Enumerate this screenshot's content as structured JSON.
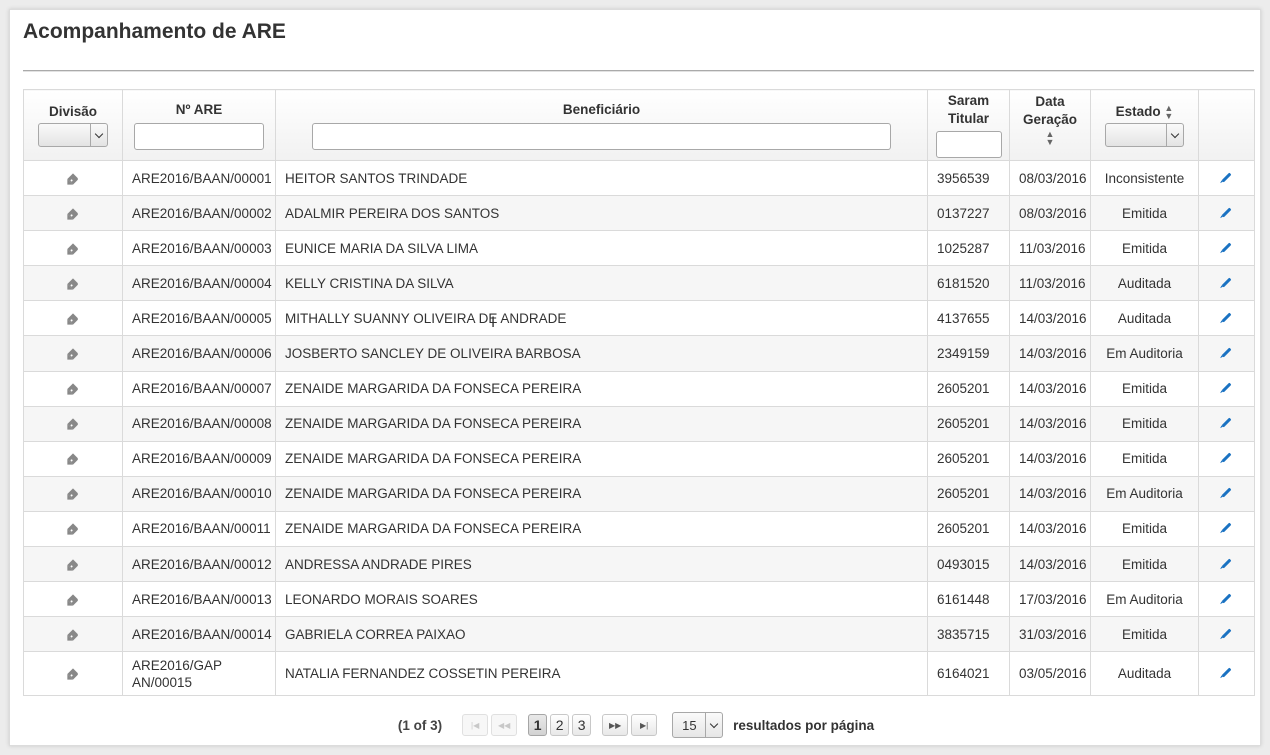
{
  "page": {
    "title": "Acompanhamento de ARE"
  },
  "table": {
    "headers": {
      "divisao": "Divisão",
      "numero": "Nº ARE",
      "beneficiario": "Beneficiário",
      "saram": "Saram Titular",
      "data": "Data Geração",
      "estado": "Estado"
    },
    "rows": [
      {
        "numero": "ARE2016/BAAN/00001",
        "beneficiario": "HEITOR SANTOS TRINDADE",
        "saram": "3956539",
        "data": "08/03/2016",
        "estado": "Inconsistente"
      },
      {
        "numero": "ARE2016/BAAN/00002",
        "beneficiario": "ADALMIR PEREIRA DOS SANTOS",
        "saram": "0137227",
        "data": "08/03/2016",
        "estado": "Emitida"
      },
      {
        "numero": "ARE2016/BAAN/00003",
        "beneficiario": "EUNICE MARIA DA SILVA LIMA",
        "saram": "1025287",
        "data": "11/03/2016",
        "estado": "Emitida"
      },
      {
        "numero": "ARE2016/BAAN/00004",
        "beneficiario": "KELLY CRISTINA DA SILVA",
        "saram": "6181520",
        "data": "11/03/2016",
        "estado": "Auditada"
      },
      {
        "numero": "ARE2016/BAAN/00005",
        "beneficiario": "MITHALLY SUANNY OLIVEIRA DE ANDRADE",
        "saram": "4137655",
        "data": "14/03/2016",
        "estado": "Auditada"
      },
      {
        "numero": "ARE2016/BAAN/00006",
        "beneficiario": "JOSBERTO SANCLEY DE OLIVEIRA BARBOSA",
        "saram": "2349159",
        "data": "14/03/2016",
        "estado": "Em Auditoria"
      },
      {
        "numero": "ARE2016/BAAN/00007",
        "beneficiario": "ZENAIDE MARGARIDA DA FONSECA PEREIRA",
        "saram": "2605201",
        "data": "14/03/2016",
        "estado": "Emitida"
      },
      {
        "numero": "ARE2016/BAAN/00008",
        "beneficiario": "ZENAIDE MARGARIDA DA FONSECA PEREIRA",
        "saram": "2605201",
        "data": "14/03/2016",
        "estado": "Emitida"
      },
      {
        "numero": "ARE2016/BAAN/00009",
        "beneficiario": "ZENAIDE MARGARIDA DA FONSECA PEREIRA",
        "saram": "2605201",
        "data": "14/03/2016",
        "estado": "Emitida"
      },
      {
        "numero": "ARE2016/BAAN/00010",
        "beneficiario": "ZENAIDE MARGARIDA DA FONSECA PEREIRA",
        "saram": "2605201",
        "data": "14/03/2016",
        "estado": "Em Auditoria"
      },
      {
        "numero": "ARE2016/BAAN/00011",
        "beneficiario": "ZENAIDE MARGARIDA DA FONSECA PEREIRA",
        "saram": "2605201",
        "data": "14/03/2016",
        "estado": "Emitida"
      },
      {
        "numero": "ARE2016/BAAN/00012",
        "beneficiario": "ANDRESSA ANDRADE PIRES",
        "saram": "0493015",
        "data": "14/03/2016",
        "estado": "Emitida"
      },
      {
        "numero": "ARE2016/BAAN/00013",
        "beneficiario": "LEONARDO MORAIS SOARES",
        "saram": "6161448",
        "data": "17/03/2016",
        "estado": "Em Auditoria"
      },
      {
        "numero": "ARE2016/BAAN/00014",
        "beneficiario": "GABRIELA CORREA PAIXAO",
        "saram": "3835715",
        "data": "31/03/2016",
        "estado": "Emitida"
      },
      {
        "numero": "ARE2016/GAP AN/00015",
        "beneficiario": "NATALIA FERNANDEZ COSSETIN PEREIRA",
        "saram": "6164021",
        "data": "03/05/2016",
        "estado": "Auditada"
      }
    ]
  },
  "paginator": {
    "current": "(1 of 3)",
    "pages": [
      "1",
      "2",
      "3"
    ],
    "active_page": "1",
    "rows_per_page": "15",
    "rows_per_page_label": "resultados por página"
  },
  "icons": {
    "row_tag": "tag-icon",
    "row_edit": "pencil-icon",
    "sort": "sort-icon",
    "accent": "#1a72c2"
  }
}
